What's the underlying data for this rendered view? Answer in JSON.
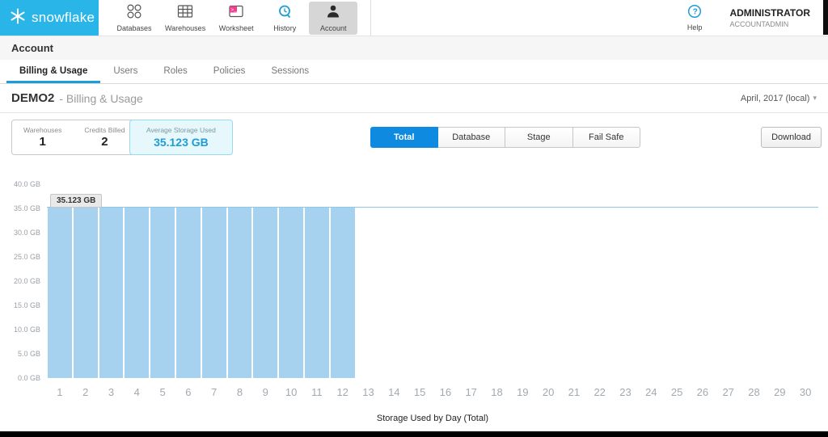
{
  "colors": {
    "brand": "#29b5e8",
    "accent": "#1e9cd7",
    "active_button": "#0e8be0",
    "bar": "#a6d2ef",
    "reference_line": "#8cc8e8",
    "storage_card_bg": "#e6f8fb"
  },
  "topnav": {
    "brand": "snowflake",
    "items": [
      {
        "label": "Databases"
      },
      {
        "label": "Warehouses"
      },
      {
        "label": "Worksheet"
      },
      {
        "label": "History"
      },
      {
        "label": "Account",
        "selected": true
      }
    ],
    "help_label": "Help",
    "user_name": "ADMINISTRATOR",
    "user_role": "ACCOUNTADMIN"
  },
  "page": {
    "title": "Account"
  },
  "tabs": [
    {
      "label": "Billing & Usage",
      "active": true
    },
    {
      "label": "Users"
    },
    {
      "label": "Roles"
    },
    {
      "label": "Policies"
    },
    {
      "label": "Sessions"
    }
  ],
  "section": {
    "name": "DEMO2",
    "subtitle": "- Billing & Usage",
    "period": "April, 2017 (local)"
  },
  "stats": {
    "warehouses_label": "Warehouses",
    "warehouses_value": "1",
    "credits_label": "Credits Billed",
    "credits_value": "2",
    "storage_label": "Average Storage Used",
    "storage_value": "35.123 GB"
  },
  "filters": [
    {
      "label": "Total",
      "active": true
    },
    {
      "label": "Database"
    },
    {
      "label": "Stage"
    },
    {
      "label": "Fail Safe"
    }
  ],
  "download_label": "Download",
  "chart_data": {
    "type": "bar",
    "title": "",
    "xlabel": "Storage Used by Day (Total)",
    "ylabel": "",
    "x": [
      1,
      2,
      3,
      4,
      5,
      6,
      7,
      8,
      9,
      10,
      11,
      12,
      13,
      14,
      15,
      16,
      17,
      18,
      19,
      20,
      21,
      22,
      23,
      24,
      25,
      26,
      27,
      28,
      29,
      30
    ],
    "values": [
      35.123,
      35.123,
      35.123,
      35.123,
      35.123,
      35.123,
      35.123,
      35.123,
      35.123,
      35.123,
      35.123,
      35.123,
      0,
      0,
      0,
      0,
      0,
      0,
      0,
      0,
      0,
      0,
      0,
      0,
      0,
      0,
      0,
      0,
      0,
      0
    ],
    "ylim": [
      0,
      40
    ],
    "ytick_labels": [
      "40.0 GB",
      "35.0 GB",
      "30.0 GB",
      "25.0 GB",
      "20.0 GB",
      "15.0 GB",
      "10.0 GB",
      "5.0 GB",
      "0.0 GB"
    ],
    "reference_line": 35.123,
    "annotation": "35.123 GB",
    "legend": "none",
    "grid": "off"
  }
}
